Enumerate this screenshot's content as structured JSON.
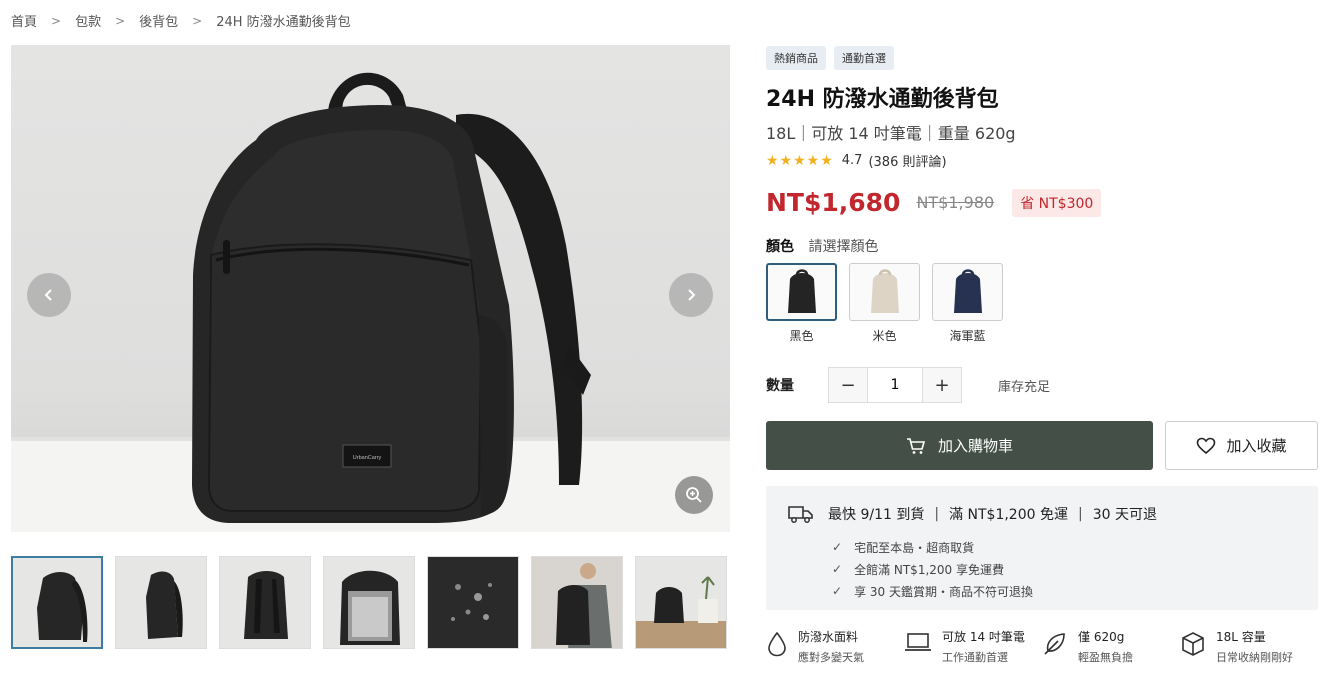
{
  "breadcrumb": [
    "首頁",
    "包款",
    "後背包",
    "24H 防潑水通勤後背包"
  ],
  "gallery": {
    "brand_label": "UrbanCarry",
    "thumb_count": 7,
    "active_thumb": 1
  },
  "product": {
    "badges": [
      "熱銷商品",
      "通勤首選"
    ],
    "title": "24H 防潑水通勤後背包",
    "subtitle": "18L｜可放 14 吋筆電｜重量 620g",
    "stars": "★★★★★",
    "rating": "4.7",
    "reviews": "(386 則評論)",
    "price": "NT$1,680",
    "original_price": "NT$1,980",
    "save_label": "省 NT$300",
    "color_label": "顏色",
    "color_hint": "請選擇顏色",
    "colors": [
      {
        "name": "黑色",
        "hex": "#242424"
      },
      {
        "name": "米色",
        "hex": "#ddd4c6"
      },
      {
        "name": "海軍藍",
        "hex": "#26324f"
      }
    ],
    "qty_label": "數量",
    "qty_value": "1",
    "stock": "庫存充足",
    "add_to_cart": "加入購物車",
    "add_to_fav": "加入收藏"
  },
  "shipping": {
    "headline": [
      "最快 9/11 到貨",
      "滿 NT$1,200 免運",
      "30 天可退"
    ],
    "items": [
      "宅配至本島・超商取貨",
      "全館滿 NT$1,200 享免運費",
      "享 30 天鑑賞期・商品不符可退換"
    ]
  },
  "features": [
    {
      "icon": "water-drop-icon",
      "title": "防潑水面料",
      "desc": "應對多變天氣"
    },
    {
      "icon": "laptop-icon",
      "title": "可放 14 吋筆電",
      "desc": "工作通勤首選"
    },
    {
      "icon": "feather-icon",
      "title": "僅 620g",
      "desc": "輕盈無負擔"
    },
    {
      "icon": "box-icon",
      "title": "18L 容量",
      "desc": "日常收納剛剛好"
    }
  ],
  "colors": {
    "price": "#c1272d",
    "cart_button": "#434f47",
    "star": "#f2b01e",
    "badge_bg": "#e8edf3"
  }
}
